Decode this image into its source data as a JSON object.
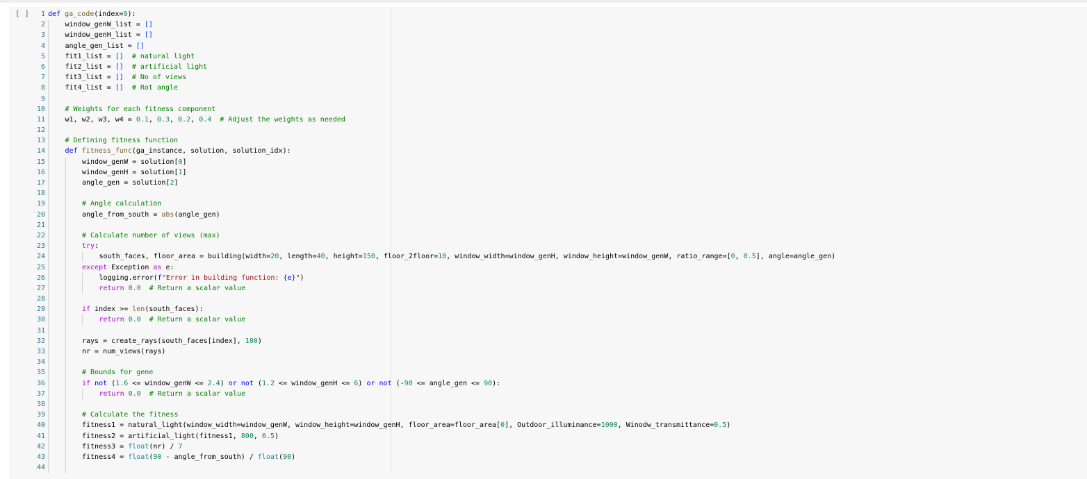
{
  "cell": {
    "run_button_label": "[ ]",
    "lines": [
      {
        "n": "1",
        "indent": 0,
        "segs": [
          [
            "k",
            "def "
          ],
          [
            "f",
            "ga_code"
          ],
          [
            "",
            "(index="
          ],
          [
            "n",
            "9"
          ],
          [
            "",
            "):"
          ]
        ]
      },
      {
        "n": "2",
        "indent": 1,
        "segs": [
          [
            "",
            "window_genW_list = "
          ],
          [
            "p",
            "[]"
          ]
        ]
      },
      {
        "n": "3",
        "indent": 1,
        "segs": [
          [
            "",
            "window_genH_list = "
          ],
          [
            "p",
            "[]"
          ]
        ]
      },
      {
        "n": "4",
        "indent": 1,
        "segs": [
          [
            "",
            "angle_gen_list = "
          ],
          [
            "p",
            "[]"
          ]
        ]
      },
      {
        "n": "5",
        "indent": 1,
        "segs": [
          [
            "",
            "fit1_list = "
          ],
          [
            "p",
            "[]"
          ],
          [
            "c",
            "  # natural light"
          ]
        ]
      },
      {
        "n": "6",
        "indent": 1,
        "segs": [
          [
            "",
            "fit2_list = "
          ],
          [
            "p",
            "[]"
          ],
          [
            "c",
            "  # artificial light"
          ]
        ]
      },
      {
        "n": "7",
        "indent": 1,
        "segs": [
          [
            "",
            "fit3_list = "
          ],
          [
            "p",
            "[]"
          ],
          [
            "c",
            "  # No of views"
          ]
        ]
      },
      {
        "n": "8",
        "indent": 1,
        "segs": [
          [
            "",
            "fit4_list = "
          ],
          [
            "p",
            "[]"
          ],
          [
            "c",
            "  # Rot angle"
          ]
        ]
      },
      {
        "n": "9",
        "indent": 1,
        "segs": []
      },
      {
        "n": "10",
        "indent": 1,
        "segs": [
          [
            "c",
            "# Weights for each fitness component"
          ]
        ]
      },
      {
        "n": "11",
        "indent": 1,
        "segs": [
          [
            "",
            "w1, w2, w3, w4 = "
          ],
          [
            "n",
            "0.1"
          ],
          [
            "",
            ", "
          ],
          [
            "n",
            "0.3"
          ],
          [
            "",
            ", "
          ],
          [
            "n",
            "0.2"
          ],
          [
            "",
            ", "
          ],
          [
            "n",
            "0.4"
          ],
          [
            "c",
            "  # Adjust the weights as needed"
          ]
        ]
      },
      {
        "n": "12",
        "indent": 1,
        "segs": []
      },
      {
        "n": "13",
        "indent": 1,
        "segs": [
          [
            "c",
            "# Defining fitness function"
          ]
        ]
      },
      {
        "n": "14",
        "indent": 1,
        "segs": [
          [
            "k",
            "def "
          ],
          [
            "f",
            "fitness_func"
          ],
          [
            "",
            "(ga_instance, solution, solution_idx):"
          ]
        ]
      },
      {
        "n": "15",
        "indent": 2,
        "segs": [
          [
            "",
            "window_genW = solution["
          ],
          [
            "n",
            "0"
          ],
          [
            "",
            "]"
          ]
        ]
      },
      {
        "n": "16",
        "indent": 2,
        "segs": [
          [
            "",
            "window_genH = solution["
          ],
          [
            "n",
            "1"
          ],
          [
            "",
            "]"
          ]
        ]
      },
      {
        "n": "17",
        "indent": 2,
        "segs": [
          [
            "",
            "angle_gen = solution["
          ],
          [
            "n",
            "2"
          ],
          [
            "",
            "]"
          ]
        ]
      },
      {
        "n": "18",
        "indent": 2,
        "segs": []
      },
      {
        "n": "19",
        "indent": 2,
        "segs": [
          [
            "c",
            "# Angle calculation"
          ]
        ]
      },
      {
        "n": "20",
        "indent": 2,
        "segs": [
          [
            "",
            "angle_from_south = "
          ],
          [
            "f",
            "abs"
          ],
          [
            "",
            "(angle_gen)"
          ]
        ]
      },
      {
        "n": "21",
        "indent": 2,
        "segs": []
      },
      {
        "n": "22",
        "indent": 2,
        "segs": [
          [
            "c",
            "# Calculate number of views (max)"
          ]
        ]
      },
      {
        "n": "23",
        "indent": 2,
        "segs": [
          [
            "x",
            "try"
          ],
          [
            "",
            ":"
          ]
        ]
      },
      {
        "n": "24",
        "indent": 3,
        "segs": [
          [
            "",
            "south_faces, floor_area = building(width="
          ],
          [
            "n",
            "20"
          ],
          [
            "",
            ", length="
          ],
          [
            "n",
            "40"
          ],
          [
            "",
            ", height="
          ],
          [
            "n",
            "150"
          ],
          [
            "",
            ", floor_2floor="
          ],
          [
            "n",
            "10"
          ],
          [
            "",
            ", window_width=window_genH, window_height=window_genW, ratio_range=["
          ],
          [
            "n",
            "0"
          ],
          [
            "",
            ", "
          ],
          [
            "n",
            "0.5"
          ],
          [
            "",
            "], angle=angle_gen)"
          ]
        ]
      },
      {
        "n": "25",
        "indent": 2,
        "segs": [
          [
            "x",
            "except "
          ],
          [
            "",
            "Exception "
          ],
          [
            "x",
            "as "
          ],
          [
            "",
            "e:"
          ]
        ]
      },
      {
        "n": "26",
        "indent": 3,
        "segs": [
          [
            "",
            "logging.error("
          ],
          [
            "k",
            "f"
          ],
          [
            "s",
            "\"Error in building function: "
          ],
          [
            "k",
            "{e}"
          ],
          [
            "s",
            "\""
          ],
          [
            "",
            ")"
          ]
        ]
      },
      {
        "n": "27",
        "indent": 3,
        "segs": [
          [
            "x",
            "return "
          ],
          [
            "n",
            "0.0"
          ],
          [
            "c",
            "  # Return a scalar value"
          ]
        ]
      },
      {
        "n": "28",
        "indent": 2,
        "segs": []
      },
      {
        "n": "29",
        "indent": 2,
        "segs": [
          [
            "x",
            "if "
          ],
          [
            "",
            "index >= "
          ],
          [
            "f",
            "len"
          ],
          [
            "",
            "(south_faces):"
          ]
        ]
      },
      {
        "n": "30",
        "indent": 3,
        "segs": [
          [
            "x",
            "return "
          ],
          [
            "n",
            "0.0"
          ],
          [
            "c",
            "  # Return a scalar value"
          ]
        ]
      },
      {
        "n": "31",
        "indent": 2,
        "segs": []
      },
      {
        "n": "32",
        "indent": 2,
        "segs": [
          [
            "",
            "rays = create_rays(south_faces[index], "
          ],
          [
            "n",
            "100"
          ],
          [
            "",
            ")"
          ]
        ]
      },
      {
        "n": "33",
        "indent": 2,
        "segs": [
          [
            "",
            "nr = num_views(rays)"
          ]
        ]
      },
      {
        "n": "34",
        "indent": 2,
        "segs": []
      },
      {
        "n": "35",
        "indent": 2,
        "segs": [
          [
            "c",
            "# Bounds for gene"
          ]
        ]
      },
      {
        "n": "36",
        "indent": 2,
        "segs": [
          [
            "x",
            "if "
          ],
          [
            "k",
            "not "
          ],
          [
            "",
            "("
          ],
          [
            "n",
            "1.6"
          ],
          [
            "",
            " <= window_genW <= "
          ],
          [
            "n",
            "2.4"
          ],
          [
            "",
            ") "
          ],
          [
            "k",
            "or not "
          ],
          [
            "",
            "("
          ],
          [
            "n",
            "1.2"
          ],
          [
            "",
            " <= window_genH <= "
          ],
          [
            "n",
            "6"
          ],
          [
            "",
            ") "
          ],
          [
            "k",
            "or not "
          ],
          [
            "",
            "(-"
          ],
          [
            "n",
            "90"
          ],
          [
            "",
            " <= angle_gen <= "
          ],
          [
            "n",
            "90"
          ],
          [
            "",
            "):"
          ]
        ]
      },
      {
        "n": "37",
        "indent": 3,
        "segs": [
          [
            "x",
            "return "
          ],
          [
            "n",
            "0.0"
          ],
          [
            "c",
            "  # Return a scalar value"
          ]
        ]
      },
      {
        "n": "38",
        "indent": 2,
        "segs": []
      },
      {
        "n": "39",
        "indent": 2,
        "segs": [
          [
            "c",
            "# Calculate the fitness"
          ]
        ]
      },
      {
        "n": "40",
        "indent": 2,
        "segs": [
          [
            "",
            "fitness1 = natural_light(window_width=window_genW, window_height=window_genH, floor_area=floor_area["
          ],
          [
            "n",
            "0"
          ],
          [
            "",
            "], Outdoor_illuminance="
          ],
          [
            "n",
            "1000"
          ],
          [
            "",
            ", Winodw_transmittance="
          ],
          [
            "n",
            "0.5"
          ],
          [
            "",
            ")"
          ]
        ]
      },
      {
        "n": "41",
        "indent": 2,
        "segs": [
          [
            "",
            "fitness2 = artificial_light(fitness1, "
          ],
          [
            "n",
            "800"
          ],
          [
            "",
            ", "
          ],
          [
            "n",
            "0.5"
          ],
          [
            "",
            ")"
          ]
        ]
      },
      {
        "n": "42",
        "indent": 2,
        "segs": [
          [
            "",
            "fitness3 = "
          ],
          [
            "b",
            "float"
          ],
          [
            "",
            "(nr) / "
          ],
          [
            "n",
            "7"
          ]
        ]
      },
      {
        "n": "43",
        "indent": 2,
        "segs": [
          [
            "",
            "fitness4 = "
          ],
          [
            "b",
            "float"
          ],
          [
            "",
            "("
          ],
          [
            "n",
            "90"
          ],
          [
            "",
            " - angle_from_south) / "
          ],
          [
            "b",
            "float"
          ],
          [
            "",
            "("
          ],
          [
            "n",
            "90"
          ],
          [
            "",
            ")"
          ]
        ]
      },
      {
        "n": "44",
        "indent": 2,
        "segs": []
      }
    ]
  }
}
